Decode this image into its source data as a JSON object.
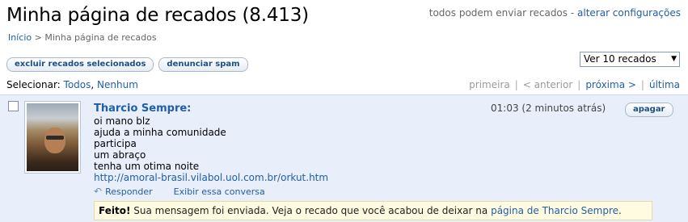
{
  "header": {
    "title": "Minha página de recados (8.413)",
    "permission_text": "todos podem enviar recados",
    "permission_sep": " - ",
    "settings_link": "alterar configurações"
  },
  "breadcrumb": {
    "home": "Início",
    "sep": " > ",
    "current": "Minha página de recados"
  },
  "toolbar": {
    "delete_selected": "excluir recados selecionados",
    "report_spam": "denunciar spam"
  },
  "view_select": {
    "selected": "Ver 10 recados",
    "arrow_icon": "dropdown-arrow-icon"
  },
  "selection": {
    "label": "Selecionar: ",
    "all": "Todos",
    "comma": ", ",
    "none": "Nenhum"
  },
  "pager": {
    "first": "primeira",
    "prev": "< anterior",
    "next": "próxima >",
    "last": "última"
  },
  "scrap": {
    "author": "Tharcio Sempre:",
    "time": "01:03 (2 minutos atrás)",
    "delete_label": "apagar",
    "lines": [
      "oi mano blz",
      "ajuda a minha comunidade",
      "participa",
      "um abraço",
      "tenha um otima noite"
    ],
    "link": "http://amoral-brasil.vilabol.uol.com.br/orkut.htm",
    "reply": "Responder",
    "show_conversation": "Exibir essa conversa"
  },
  "notice": {
    "bold": "Feito!",
    "text": " Sua mensagem foi enviada. Veja o recado que você acabou de deixar na ",
    "link": "página de Tharcio Sempre",
    "end": "."
  }
}
